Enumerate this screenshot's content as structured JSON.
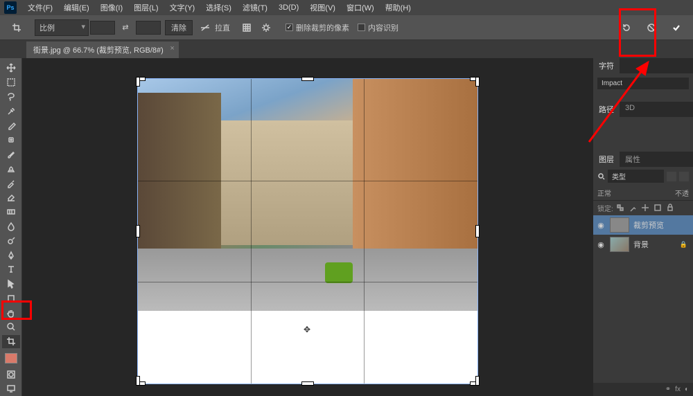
{
  "menu": {
    "items": [
      "文件(F)",
      "编辑(E)",
      "图像(I)",
      "图层(L)",
      "文字(Y)",
      "选择(S)",
      "滤镜(T)",
      "3D(D)",
      "视图(V)",
      "窗口(W)",
      "帮助(H)"
    ]
  },
  "options": {
    "ratio_label": "比例",
    "clear_label": "清除",
    "straighten_label": "拉直",
    "delete_cropped_label": "删除裁剪的像素",
    "content_aware_label": "内容识别",
    "delete_cropped_checked": true,
    "content_aware_checked": false
  },
  "document": {
    "tab_title": "街景.jpg @ 66.7% (裁剪预览, RGB/8#)"
  },
  "char_panel": {
    "tab": "字符",
    "font": "Impact"
  },
  "path_panel": {
    "tab_path": "路径",
    "tab_3d": "3D"
  },
  "layers_panel": {
    "tab_layers": "图层",
    "tab_props": "属性",
    "filter_label": "类型",
    "blend_mode": "正常",
    "opacity_label": "不透",
    "lock_label": "锁定:",
    "layers": [
      {
        "name": "裁剪预览",
        "selected": true
      },
      {
        "name": "背景",
        "locked": true
      }
    ],
    "footer_fx": "fx"
  },
  "toolbox": {
    "tools": [
      "move-tool",
      "marquee-tool",
      "lasso-tool",
      "magic-wand-tool",
      "crop-tool-top",
      "eyedropper-tool",
      "healing-brush-tool",
      "brush-tool",
      "clone-stamp-tool",
      "history-brush-tool",
      "eraser-tool",
      "gradient-tool",
      "blur-tool",
      "dodge-tool",
      "pen-tool",
      "type-tool",
      "path-selection-tool",
      "rectangle-tool",
      "hand-tool",
      "zoom-tool",
      "crop-tool-bottom"
    ]
  },
  "annotations": {}
}
